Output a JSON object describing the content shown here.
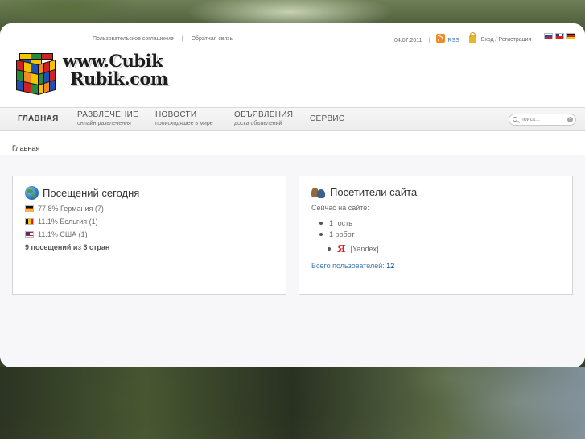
{
  "header": {
    "top_links": [
      "Пользовательское соглашение",
      "Обратная связь"
    ],
    "date": "04.07.2011",
    "rss_label": "RSS",
    "login_label": "Вход / Регистрация",
    "languages": [
      "ru",
      "en",
      "de"
    ]
  },
  "logo": {
    "line1": "www.Cubik",
    "line2": "Rubik.com"
  },
  "nav": {
    "items": [
      {
        "label": "Главная",
        "sub": ""
      },
      {
        "label": "Развлечение",
        "sub": "онлайн развлечения"
      },
      {
        "label": "Новости",
        "sub": "происходящее в мире"
      },
      {
        "label": "Объявления",
        "sub": "доска объявлений"
      },
      {
        "label": "Сервис",
        "sub": ""
      }
    ],
    "search_placeholder": "поиск..."
  },
  "breadcrumb": "Главная",
  "visits_panel": {
    "title": "Посещений сегодня",
    "rows": [
      {
        "flag": "de",
        "text": "77.8% Германия (7)"
      },
      {
        "flag": "be",
        "text": "11.1% Бельгия (1)"
      },
      {
        "flag": "us",
        "text": "11.1% США (1)"
      }
    ],
    "total": "9 посещений из 3 стран"
  },
  "visitors_panel": {
    "title": "Посетители сайта",
    "online_label": "Сейчас на сайте:",
    "items": [
      "1 гость",
      "1 робот"
    ],
    "bot": "[Yandex]",
    "bot_icon": "Я",
    "total_label": "Всего пользователей:",
    "total_value": "12"
  }
}
